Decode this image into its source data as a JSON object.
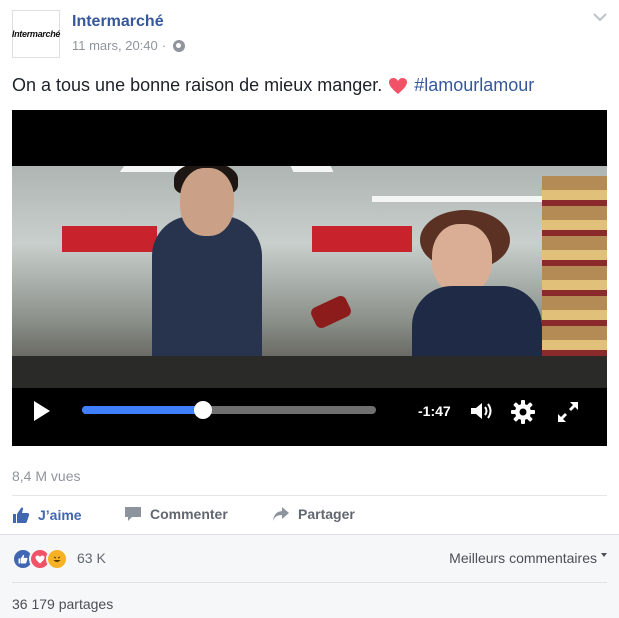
{
  "post": {
    "logo_text": "Intermarché",
    "page_name": "Intermarché",
    "timestamp": "11 mars, 20:40",
    "separator": "·",
    "text": "On a tous une bonne raison de mieux manger.",
    "hashtag": "#lamourlamour",
    "icons": {
      "visibility": "globe-icon",
      "menu": "chevron-down-icon",
      "emoji": "heart-icon"
    }
  },
  "video": {
    "time_remaining": "-1:47",
    "progress": 0.41,
    "icons": {
      "play": "play-icon",
      "volume": "volume-icon",
      "settings": "gear-icon",
      "fullscreen": "fullscreen-icon"
    }
  },
  "stats": {
    "views": "8,4 M vues",
    "reaction_count": "63 K",
    "shares": "36 179 partages",
    "sort_label": "Meilleurs commentaires"
  },
  "actions": {
    "like": "J’aime",
    "comment": "Commenter",
    "share": "Partager"
  },
  "colors": {
    "link": "#365899",
    "like_blue": "#4267b2",
    "progress_blue": "#4080ff",
    "heart_red": "#f25268",
    "haha_yellow": "#f7b125"
  }
}
